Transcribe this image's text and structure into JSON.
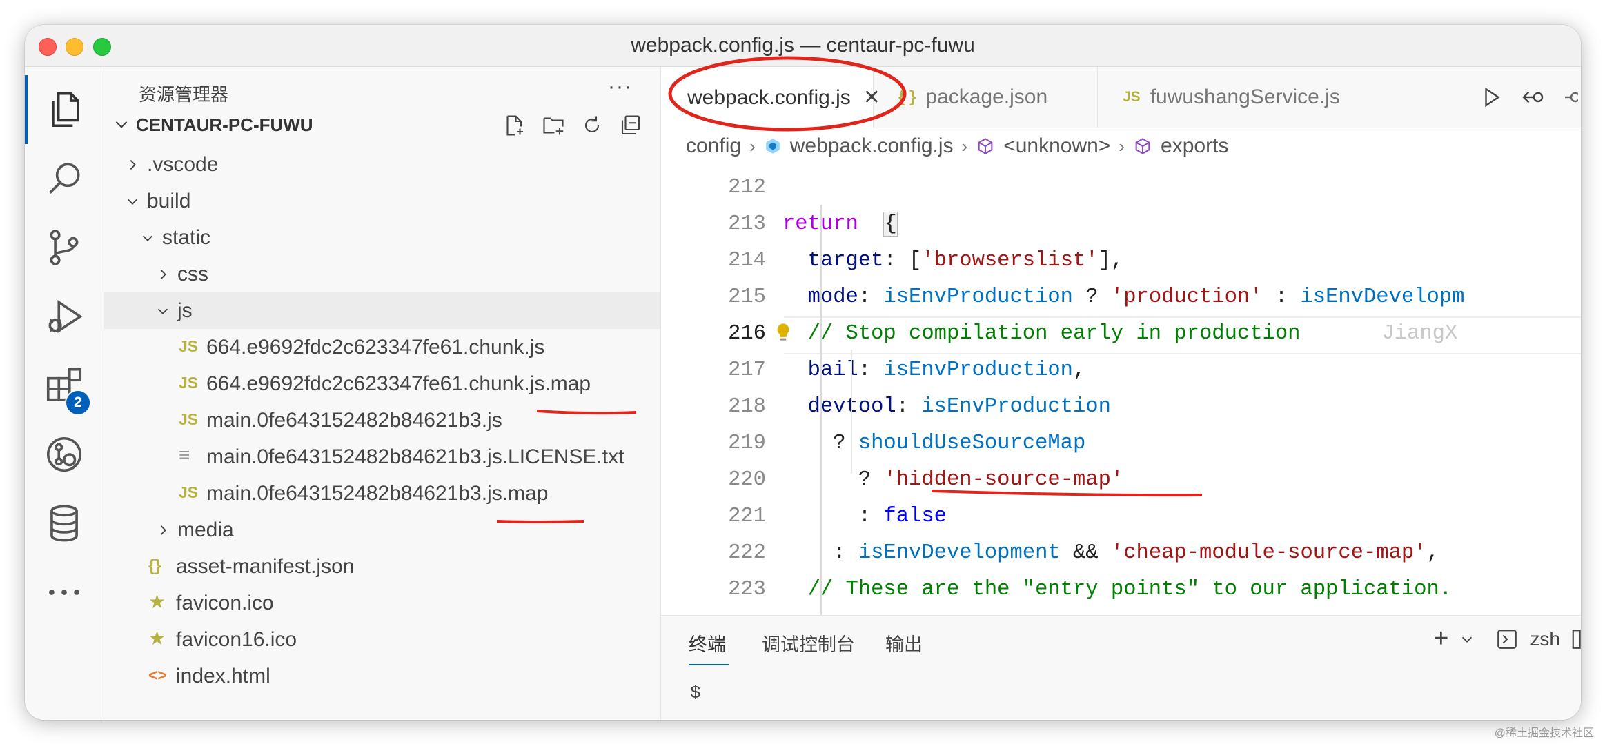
{
  "window": {
    "title": "webpack.config.js — centaur-pc-fuwu"
  },
  "activity_bar": {
    "items": [
      {
        "icon": "files-icon"
      },
      {
        "icon": "search-icon"
      },
      {
        "icon": "source-control-icon"
      },
      {
        "icon": "run-debug-icon"
      },
      {
        "icon": "extensions-icon",
        "badge": "2"
      },
      {
        "icon": "remote-explorer-icon"
      },
      {
        "icon": "database-icon"
      },
      {
        "icon": "more-icon"
      }
    ]
  },
  "sidebar": {
    "title": "资源管理器",
    "more": "···",
    "project": "CENTAUR-PC-FUWU",
    "tree": [
      {
        "label": ".vscode",
        "indent": 0,
        "type": "folder",
        "expanded": false
      },
      {
        "label": "build",
        "indent": 0,
        "type": "folder",
        "expanded": true
      },
      {
        "label": "static",
        "indent": 1,
        "type": "folder",
        "expanded": true
      },
      {
        "label": "css",
        "indent": 2,
        "type": "folder",
        "expanded": false
      },
      {
        "label": "js",
        "indent": 2,
        "type": "folder",
        "expanded": true,
        "selected": true
      },
      {
        "label": "664.e9692fdc2c623347fe61.chunk.js",
        "indent": 3,
        "type": "js",
        "icon": "JS"
      },
      {
        "label": "664.e9692fdc2c623347fe61.chunk.js.map",
        "indent": 3,
        "type": "js",
        "icon": "JS"
      },
      {
        "label": "main.0fe643152482b84621b3.js",
        "indent": 3,
        "type": "js",
        "icon": "JS"
      },
      {
        "label": "main.0fe643152482b84621b3.js.LICENSE.txt",
        "indent": 3,
        "type": "txt",
        "icon": "≡"
      },
      {
        "label": "main.0fe643152482b84621b3.js.map",
        "indent": 3,
        "type": "js",
        "icon": "JS"
      },
      {
        "label": "media",
        "indent": 2,
        "type": "folder",
        "expanded": false
      },
      {
        "label": "asset-manifest.json",
        "indent": 1,
        "type": "json",
        "icon": "{}"
      },
      {
        "label": "favicon.ico",
        "indent": 1,
        "type": "star",
        "icon": "★"
      },
      {
        "label": "favicon16.ico",
        "indent": 1,
        "type": "star",
        "icon": "★"
      },
      {
        "label": "index.html",
        "indent": 1,
        "type": "html",
        "icon": "<>"
      }
    ]
  },
  "tabs": [
    {
      "label": "webpack.config.js",
      "icon": "webpack",
      "active": true,
      "close": "✕"
    },
    {
      "label": "package.json",
      "icon": "{ }",
      "active": false
    },
    {
      "label": "fuwushangService.js",
      "icon": "JS",
      "active": false
    }
  ],
  "breadcrumb": [
    "config",
    "webpack.config.js",
    "<unknown>",
    "exports"
  ],
  "editor": {
    "current_line": 216,
    "blame": "JiangX",
    "lines": [
      {
        "n": "212",
        "tokens": []
      },
      {
        "n": "213",
        "tokens": [
          [
            "kw",
            "return"
          ],
          [
            "",
            "  "
          ],
          [
            "bracket",
            "{"
          ]
        ]
      },
      {
        "n": "214",
        "tokens": [
          [
            "",
            "  "
          ],
          [
            "prop",
            "target"
          ],
          [
            "",
            ": ["
          ],
          [
            "str",
            "'browserslist'"
          ],
          [
            "",
            "],"
          ]
        ]
      },
      {
        "n": "215",
        "tokens": [
          [
            "",
            "  "
          ],
          [
            "prop",
            "mode"
          ],
          [
            "",
            ": "
          ],
          [
            "var",
            "isEnvProduction"
          ],
          [
            "",
            " ? "
          ],
          [
            "str",
            "'production'"
          ],
          [
            "",
            " : "
          ],
          [
            "var",
            "isEnvDevelopm"
          ]
        ]
      },
      {
        "n": "216",
        "tokens": [
          [
            "",
            "  "
          ],
          [
            "cmt",
            "// Stop compilation early in production"
          ]
        ]
      },
      {
        "n": "217",
        "tokens": [
          [
            "",
            "  "
          ],
          [
            "prop",
            "bail"
          ],
          [
            "",
            ": "
          ],
          [
            "var",
            "isEnvProduction"
          ],
          [
            "",
            ","
          ]
        ]
      },
      {
        "n": "218",
        "tokens": [
          [
            "",
            "  "
          ],
          [
            "prop",
            "devtool"
          ],
          [
            "",
            ": "
          ],
          [
            "var",
            "isEnvProduction"
          ]
        ]
      },
      {
        "n": "219",
        "tokens": [
          [
            "",
            "    ? "
          ],
          [
            "var",
            "shouldUseSourceMap"
          ]
        ]
      },
      {
        "n": "220",
        "tokens": [
          [
            "",
            "      ? "
          ],
          [
            "str",
            "'hidden-source-map'"
          ]
        ]
      },
      {
        "n": "221",
        "tokens": [
          [
            "",
            "      : "
          ],
          [
            "bool",
            "false"
          ]
        ]
      },
      {
        "n": "222",
        "tokens": [
          [
            "",
            "    : "
          ],
          [
            "var",
            "isEnvDevelopment"
          ],
          [
            "",
            " && "
          ],
          [
            "str",
            "'cheap-module-source-map'"
          ],
          [
            "",
            ","
          ]
        ]
      },
      {
        "n": "223",
        "tokens": [
          [
            "",
            "  "
          ],
          [
            "cmt",
            "// These are the \"entry points\" to our application."
          ]
        ]
      }
    ]
  },
  "panel": {
    "tabs": [
      "终端",
      "调试控制台",
      "输出"
    ],
    "active_tab": "终端",
    "prompt": "$",
    "shell": "zsh",
    "add": "+"
  },
  "watermark": "@稀土掘金技术社区",
  "colors": {
    "accent": "#005fb8",
    "annotation": "#e0261c"
  }
}
